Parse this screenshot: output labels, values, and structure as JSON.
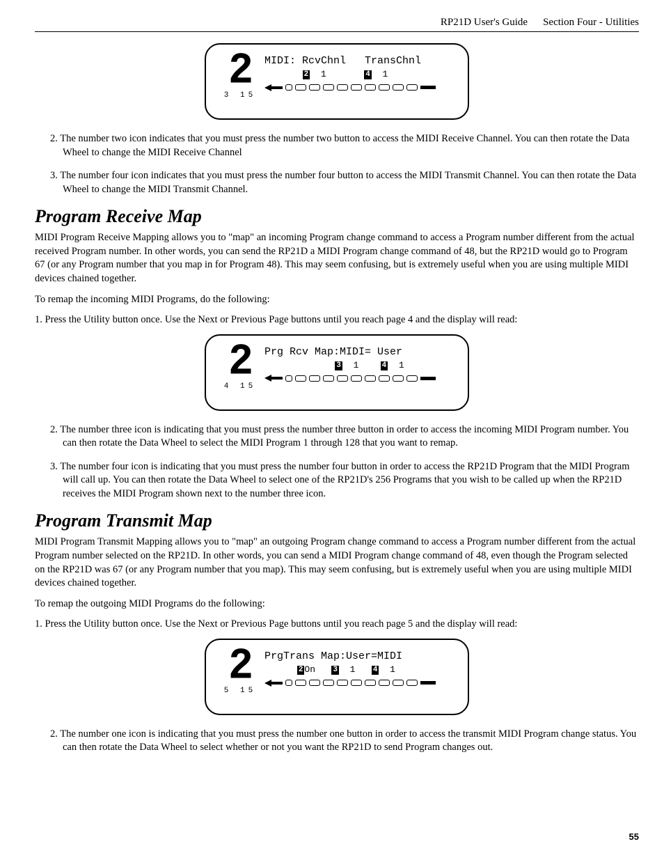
{
  "header": {
    "left": "RP21D User's Guide",
    "right": "Section Four - Utilities"
  },
  "display1": {
    "big": "2",
    "sub": "3 15",
    "line1": "MIDI: RcvChnl   TransChnl",
    "line2_a": "2",
    "line2_av": "  1",
    "line2_b": "4",
    "line2_bv": "  1"
  },
  "list1": {
    "i2": "2. The number two icon indicates that you must press the number two button to access the MIDI Receive Channel. You can then rotate the Data Wheel to change the MIDI Receive Channel",
    "i3": "3. The number four icon indicates that you must press the number four button to access the MIDI Transmit Channel. You can then rotate the Data Wheel to change the MIDI Transmit Channel."
  },
  "section1": {
    "title": "Program Receive Map",
    "p1": "MIDI Program Receive Mapping allows you to \"map\" an incoming Program change command to access a Program number different from the actual received Program  number. In other words, you can send the RP21D a MIDI Program change command of  48, but the RP21D would go to Program 67 (or any Program number that you map in for Program 48). This may seem confusing, but is extremely useful when you are using multiple MIDI devices chained together.",
    "p2": "To remap the incoming MIDI Programs, do the following:",
    "step1": "1. Press the Utility button once.  Use the Next or Previous Page buttons until you reach page 4 and the display will read:"
  },
  "display2": {
    "big": "2",
    "sub": "4 15",
    "line1": "Prg Rcv Map:MIDI= User",
    "line2_a": "3",
    "line2_av": "  1",
    "line2_b": "4",
    "line2_bv": "  1"
  },
  "list2": {
    "i2": "2. The number three icon is indicating that you must press the number three button in order to access the incoming MIDI Program number. You can then rotate the Data Wheel to select the MIDI Program 1 through 128 that you want to remap.",
    "i3": "3. The number four icon is indicating that you must press the number four button in order to access the RP21D Program that the MIDI Program will call up. You can then rotate the Data Wheel to select one of the RP21D's 256 Programs that you wish to be called up when the RP21D receives the MIDI Program shown next to the number three icon."
  },
  "section2": {
    "title": "Program Transmit Map",
    "p1": "MIDI Program Transmit Mapping allows you to \"map\" an outgoing Program change command to access a Program number different from the actual Program  number selected on the RP21D. In other words, you can send a MIDI Program change command of  48, even though the Program selected on the RP21D was 67 (or any Program number that you map). This may seem confusing, but is extremely useful when you are using multiple MIDI devices chained together.",
    "p2": "To remap the outgoing MIDI Programs do the following:",
    "step1": "1. Press the Utility button once.  Use the Next or Previous Page buttons until you reach page 5 and the display will read:"
  },
  "display3": {
    "big": "2",
    "sub": "5 15",
    "line1": "PrgTrans Map:User=MIDI",
    "line2_a": "2",
    "line2_av": "On",
    "line2_b": "3",
    "line2_bv": "  1",
    "line2_c": "4",
    "line2_cv": "  1"
  },
  "list3": {
    "i2": "2. The number one icon is indicating that you must press the number one button in order to access the transmit MIDI Program change status. You can then rotate the Data Wheel to select whether or not you want the RP21D to send Program changes out."
  },
  "page_number": "55"
}
